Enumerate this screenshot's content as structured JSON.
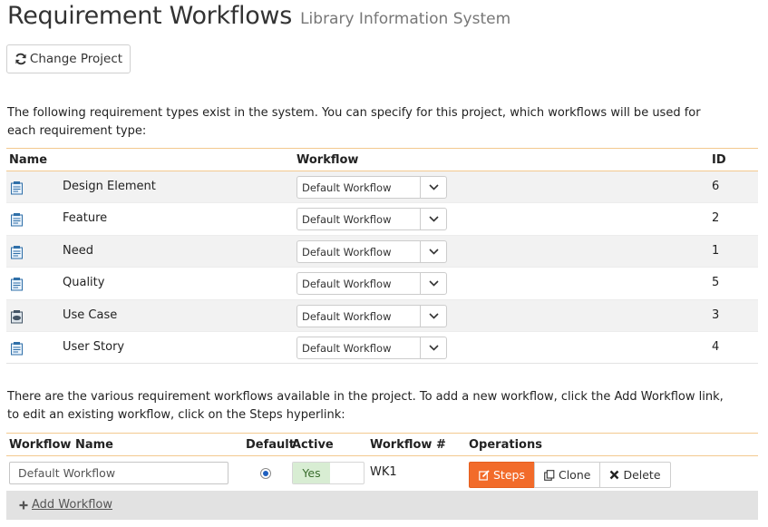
{
  "header": {
    "title": "Requirement Workflows",
    "subtitle": "Library Information System"
  },
  "toolbar": {
    "change_project_label": "Change Project",
    "change_project_icon": "refresh-icon"
  },
  "intro_text": "The following requirement types exist in the system. You can specify for this project, which workflows will be used for each requirement type:",
  "requirement_types": {
    "columns": {
      "name": "Name",
      "workflow": "Workflow",
      "id": "ID"
    },
    "rows": [
      {
        "icon": "requirement-icon",
        "name": "Design Element",
        "workflow": "Default Workflow",
        "id": "6"
      },
      {
        "icon": "requirement-icon",
        "name": "Feature",
        "workflow": "Default Workflow",
        "id": "2"
      },
      {
        "icon": "requirement-icon",
        "name": "Need",
        "workflow": "Default Workflow",
        "id": "1"
      },
      {
        "icon": "requirement-icon",
        "name": "Quality",
        "workflow": "Default Workflow",
        "id": "5"
      },
      {
        "icon": "use-case-icon",
        "name": "Use Case",
        "workflow": "Default Workflow",
        "id": "3"
      },
      {
        "icon": "requirement-icon",
        "name": "User Story",
        "workflow": "Default Workflow",
        "id": "4"
      }
    ]
  },
  "workflows_intro": "There are the various requirement workflows available in the project. To add a new workflow, click the Add Workflow link, to edit an existing workflow, click on the Steps hyperlink:",
  "workflows": {
    "columns": {
      "name": "Workflow Name",
      "default": "Default",
      "active": "Active",
      "number": "Workflow #",
      "operations": "Operations"
    },
    "rows": [
      {
        "name": "Default Workflow",
        "is_default": true,
        "active_label": "Yes",
        "number": "WK1",
        "steps_label": "Steps",
        "clone_label": "Clone",
        "delete_label": "Delete"
      }
    ],
    "add_label": "Add Workflow"
  },
  "colors": {
    "accent": "#f26b2a",
    "header_border": "#f3c98f",
    "active_bg": "#d8edd3",
    "alt_row": "#f2f2f2"
  }
}
